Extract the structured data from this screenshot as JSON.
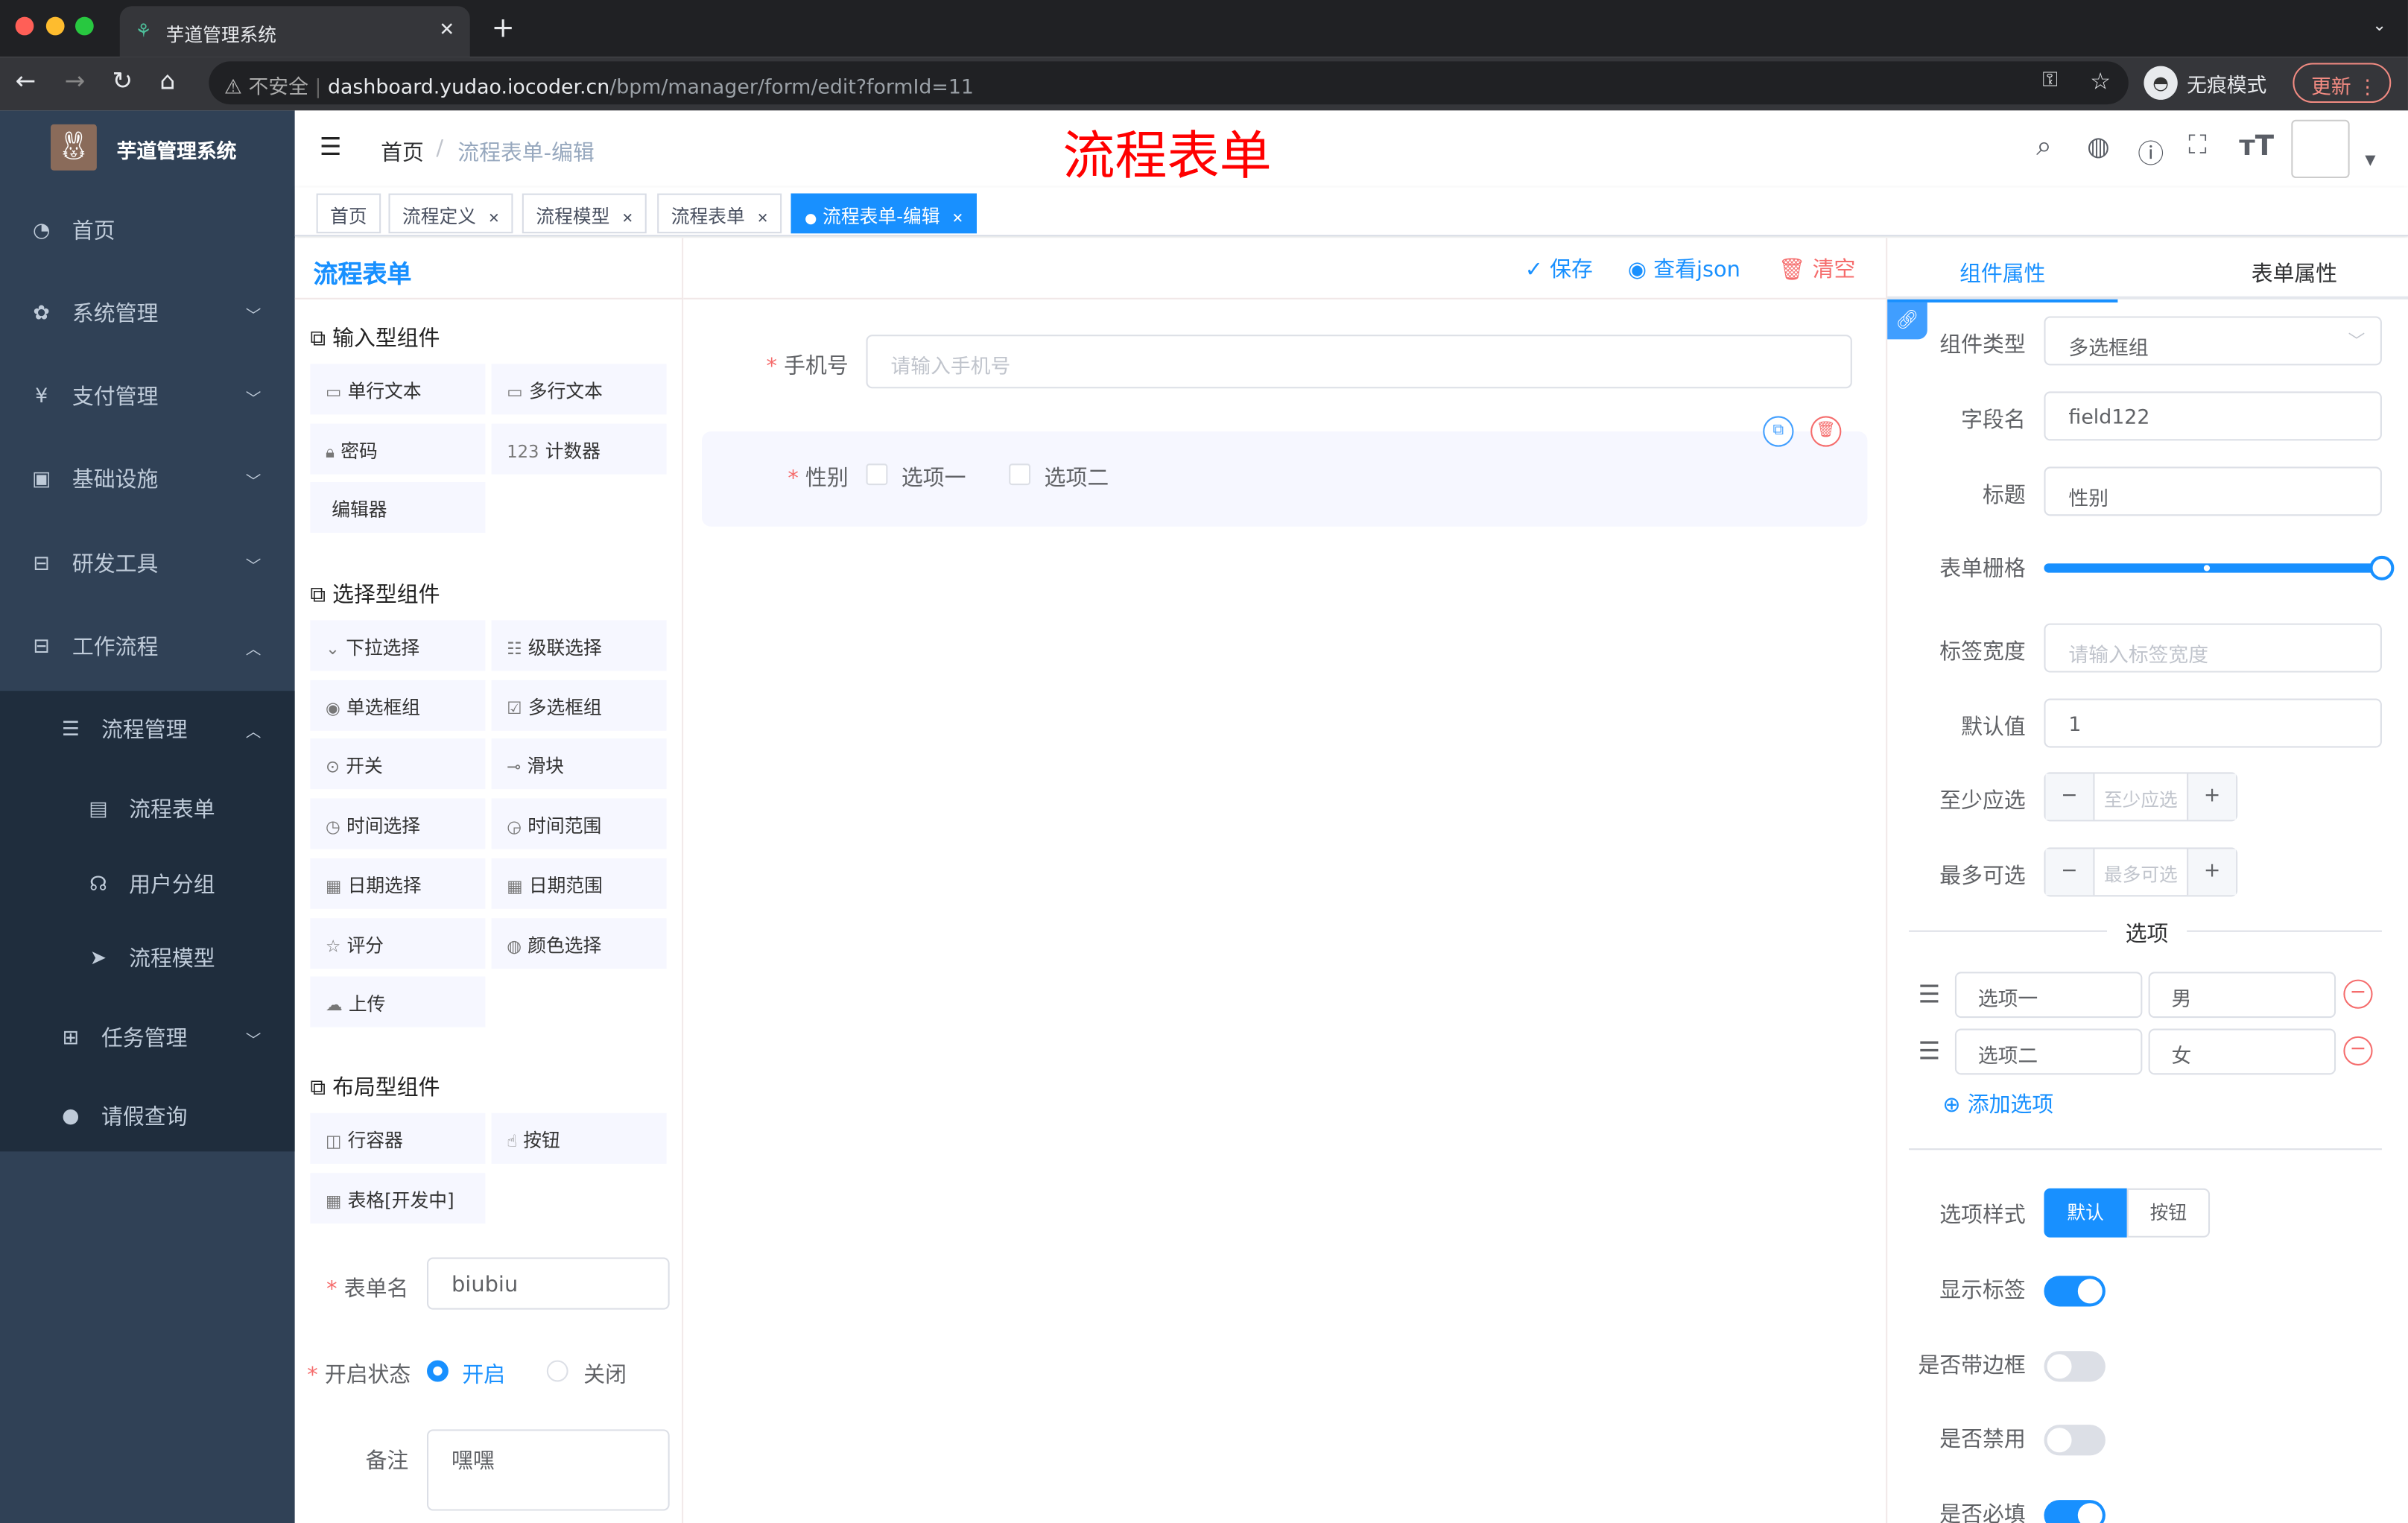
{
  "browser": {
    "tab_title": "芋道管理系统",
    "security": "不安全",
    "url_host": "dashboard.yudao.iocoder.cn",
    "url_path": "/bpm/manager/form/edit?formId=11",
    "incognito": "无痕模式",
    "update": "更新"
  },
  "sidebar": {
    "logo_title": "芋道管理系统",
    "items": [
      {
        "label": "首页",
        "icon": "dashboard-icon"
      },
      {
        "label": "系统管理",
        "icon": "gear-icon"
      },
      {
        "label": "支付管理",
        "icon": "yen-icon"
      },
      {
        "label": "基础设施",
        "icon": "monitor-icon"
      },
      {
        "label": "研发工具",
        "icon": "toolbox-icon"
      },
      {
        "label": "工作流程",
        "icon": "toolbox-icon"
      }
    ],
    "sub": [
      {
        "label": "流程管理"
      },
      {
        "label": "流程表单"
      },
      {
        "label": "用户分组"
      },
      {
        "label": "流程模型"
      },
      {
        "label": "任务管理"
      },
      {
        "label": "请假查询"
      }
    ]
  },
  "navbar": {
    "breadcrumb_home": "首页",
    "breadcrumb_current": "流程表单-编辑",
    "overlay_title": "流程表单"
  },
  "tags": [
    "首页",
    "流程定义",
    "流程模型",
    "流程表单",
    "流程表单-编辑"
  ],
  "left": {
    "title": "流程表单",
    "input_section": "输入型组件",
    "input_items": [
      {
        "label": "单行文本",
        "icon": "▭"
      },
      {
        "label": "多行文本",
        "icon": "▭"
      },
      {
        "label": "密码",
        "icon": "🔒︎"
      },
      {
        "label": "计数器",
        "icon": "123"
      },
      {
        "label": "编辑器",
        "icon": ""
      }
    ],
    "select_section": "选择型组件",
    "select_items": [
      {
        "label": "下拉选择",
        "icon": "⌄"
      },
      {
        "label": "级联选择",
        "icon": "☷"
      },
      {
        "label": "单选框组",
        "icon": "◉"
      },
      {
        "label": "多选框组",
        "icon": "☑"
      },
      {
        "label": "开关",
        "icon": "⊙"
      },
      {
        "label": "滑块",
        "icon": "⊸"
      },
      {
        "label": "时间选择",
        "icon": "◷"
      },
      {
        "label": "时间范围",
        "icon": "◶"
      },
      {
        "label": "日期选择",
        "icon": "▦"
      },
      {
        "label": "日期范围",
        "icon": "▦"
      },
      {
        "label": "评分",
        "icon": "☆"
      },
      {
        "label": "颜色选择",
        "icon": "◍"
      },
      {
        "label": "上传",
        "icon": "☁"
      }
    ],
    "layout_section": "布局型组件",
    "layout_items": [
      {
        "label": "行容器",
        "icon": "◫"
      },
      {
        "label": "按钮",
        "icon": "☝"
      },
      {
        "label": "表格[开发中]",
        "icon": "▦"
      }
    ],
    "form_name_label": "表单名",
    "form_name_value": "biubiu",
    "status_label": "开启状态",
    "status_on": "开启",
    "status_off": "关闭",
    "remark_label": "备注",
    "remark_value": "嘿嘿"
  },
  "toolbar": {
    "save": "保存",
    "view_json": "查看json",
    "clear": "清空"
  },
  "canvas": {
    "phone_label": "手机号",
    "phone_placeholder": "请输入手机号",
    "gender_label": "性别",
    "option1": "选项一",
    "option2": "选项二"
  },
  "right": {
    "tab_component": "组件属性",
    "tab_form": "表单属性",
    "type_label": "组件类型",
    "type_value": "多选框组",
    "field_label": "字段名",
    "field_value": "field122",
    "title_label": "标题",
    "title_value": "性别",
    "grid_label": "表单栅格",
    "grid_value_percent": 100,
    "label_width_label": "标签宽度",
    "label_width_placeholder": "请输入标签宽度",
    "default_label": "默认值",
    "default_value": "1",
    "min_label": "至少应选",
    "min_placeholder": "至少应选",
    "max_label": "最多可选",
    "max_placeholder": "最多可选",
    "options_divider": "选项",
    "options": [
      {
        "label": "选项一",
        "value": "男"
      },
      {
        "label": "选项二",
        "value": "女"
      }
    ],
    "add_option": "添加选项",
    "style_label": "选项样式",
    "style_default": "默认",
    "style_button": "按钮",
    "show_label": "显示标签",
    "show_label_on": true,
    "border_label": "是否带边框",
    "border_on": false,
    "disabled_label": "是否禁用",
    "disabled_on": false,
    "required_label": "是否必填",
    "required_on": true
  },
  "colors": {
    "accent": "#1890ff",
    "sidebar": "#304156",
    "danger": "#f56c6c",
    "overlay_title": "#ff0000"
  }
}
